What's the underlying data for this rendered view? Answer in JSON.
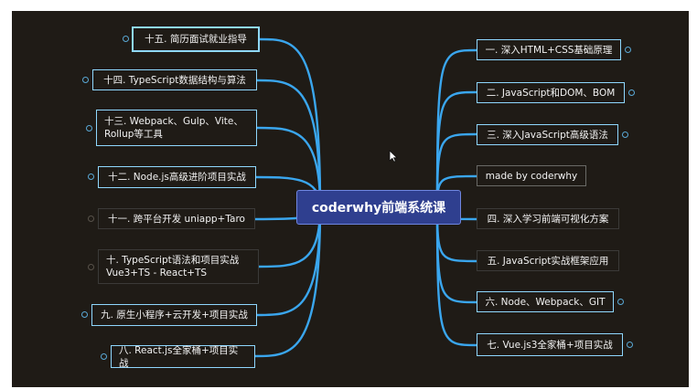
{
  "mindmap": {
    "center": "coderwhy前端系统课",
    "right": [
      {
        "label": "一. 深入HTML+CSS基础原理"
      },
      {
        "label": "二. JavaScript和DOM、BOM"
      },
      {
        "label": "三. 深入JavaScript高级语法"
      },
      {
        "label": "made by coderwhy"
      },
      {
        "label": "四. 深入学习前端可视化方案"
      },
      {
        "label": "五. JavaScript实战框架应用"
      },
      {
        "label": "六. Node、Webpack、GIT"
      },
      {
        "label": "七. Vue.js3全家桶+项目实战"
      }
    ],
    "left": [
      {
        "label": "十五. 简历面试就业指导"
      },
      {
        "label": "十四. TypeScript数据结构与算法"
      },
      {
        "label": "十三. Webpack、Gulp、Vite、\nRollup等工具"
      },
      {
        "label": "十二. Node.js高级进阶项目实战"
      },
      {
        "label": "十一. 跨平台开发 uniapp+Taro"
      },
      {
        "label": "十. TypeScript语法和项目实战\nVue3+TS - React+TS"
      },
      {
        "label": "九. 原生小程序+云开发+项目实战"
      },
      {
        "label": "八. React.js全家桶+项目实战"
      }
    ]
  },
  "colors": {
    "background": "#1f1b16",
    "center_fill": "#2f3f8f",
    "link_blue": "#3aa6ee",
    "node_border": "#8fd8ff"
  }
}
